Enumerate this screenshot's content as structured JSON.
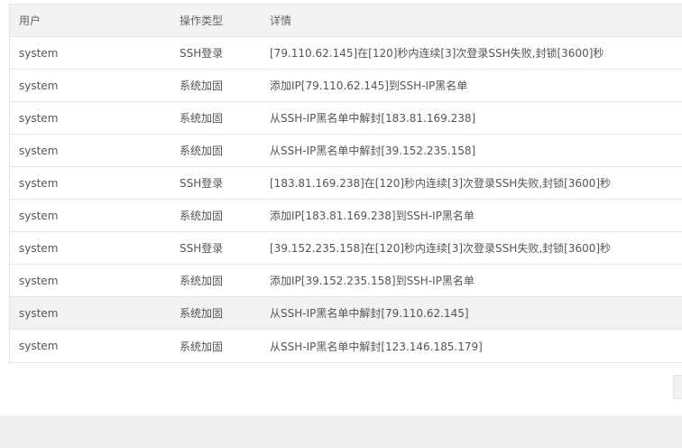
{
  "table": {
    "headers": [
      "用户",
      "操作类型",
      "详情"
    ],
    "rows": [
      {
        "user": "system",
        "type": "SSH登录",
        "detail": "[79.110.62.145]在[120]秒内连续[3]次登录SSH失败,封锁[3600]秒"
      },
      {
        "user": "system",
        "type": "系统加固",
        "detail": "添加IP[79.110.62.145]到SSH-IP黑名单"
      },
      {
        "user": "system",
        "type": "系统加固",
        "detail": "从SSH-IP黑名单中解封[183.81.169.238]"
      },
      {
        "user": "system",
        "type": "系统加固",
        "detail": "从SSH-IP黑名单中解封[39.152.235.158]"
      },
      {
        "user": "system",
        "type": "SSH登录",
        "detail": "[183.81.169.238]在[120]秒内连续[3]次登录SSH失败,封锁[3600]秒"
      },
      {
        "user": "system",
        "type": "系统加固",
        "detail": "添加IP[183.81.169.238]到SSH-IP黑名单"
      },
      {
        "user": "system",
        "type": "SSH登录",
        "detail": "[39.152.235.158]在[120]秒内连续[3]次登录SSH失败,封锁[3600]秒"
      },
      {
        "user": "system",
        "type": "系统加固",
        "detail": "添加IP[39.152.235.158]到SSH-IP黑名单"
      },
      {
        "user": "system",
        "type": "系统加固",
        "detail": "从SSH-IP黑名单中解封[79.110.62.145]"
      },
      {
        "user": "system",
        "type": "系统加固",
        "detail": "从SSH-IP黑名单中解封[123.146.185.179]"
      }
    ]
  }
}
